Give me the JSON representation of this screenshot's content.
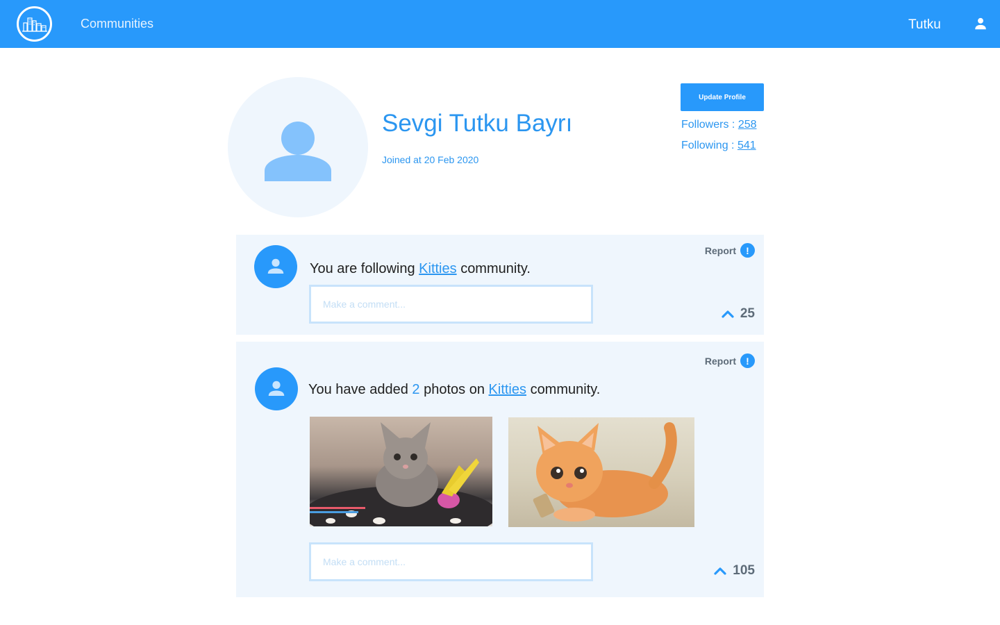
{
  "nav": {
    "communities_label": "Communities",
    "username": "Tutku",
    "logo_icon": "city-buildings-icon",
    "user_icon": "person-icon"
  },
  "profile": {
    "name": "Sevgi Tutku Bayrı",
    "joined": "Joined at 20 Feb 2020",
    "update_button": "Update Profile",
    "followers_label": "Followers :",
    "followers_count": "258",
    "following_label": "Following :",
    "following_count": "541"
  },
  "feed": [
    {
      "text_before": "You are following",
      "community": "Kitties",
      "text_after": "community.",
      "report_label": "Report",
      "report_icon": "!",
      "comment_placeholder": "Make a comment...",
      "votes": "25"
    },
    {
      "text_before": "You have added",
      "photo_count": "2",
      "text_middle": "photos on",
      "community": "Kitties",
      "text_after": "community.",
      "report_label": "Report",
      "report_icon": "!",
      "comment_placeholder": "Make a comment...",
      "votes": "105",
      "photos": [
        "tabby-kitten-photo",
        "orange-kitten-photo"
      ]
    }
  ],
  "colors": {
    "primary": "#2899fb",
    "card_bg": "#eff6fd",
    "text_blue": "#2b96f0",
    "muted_gray": "#5d6b78"
  }
}
